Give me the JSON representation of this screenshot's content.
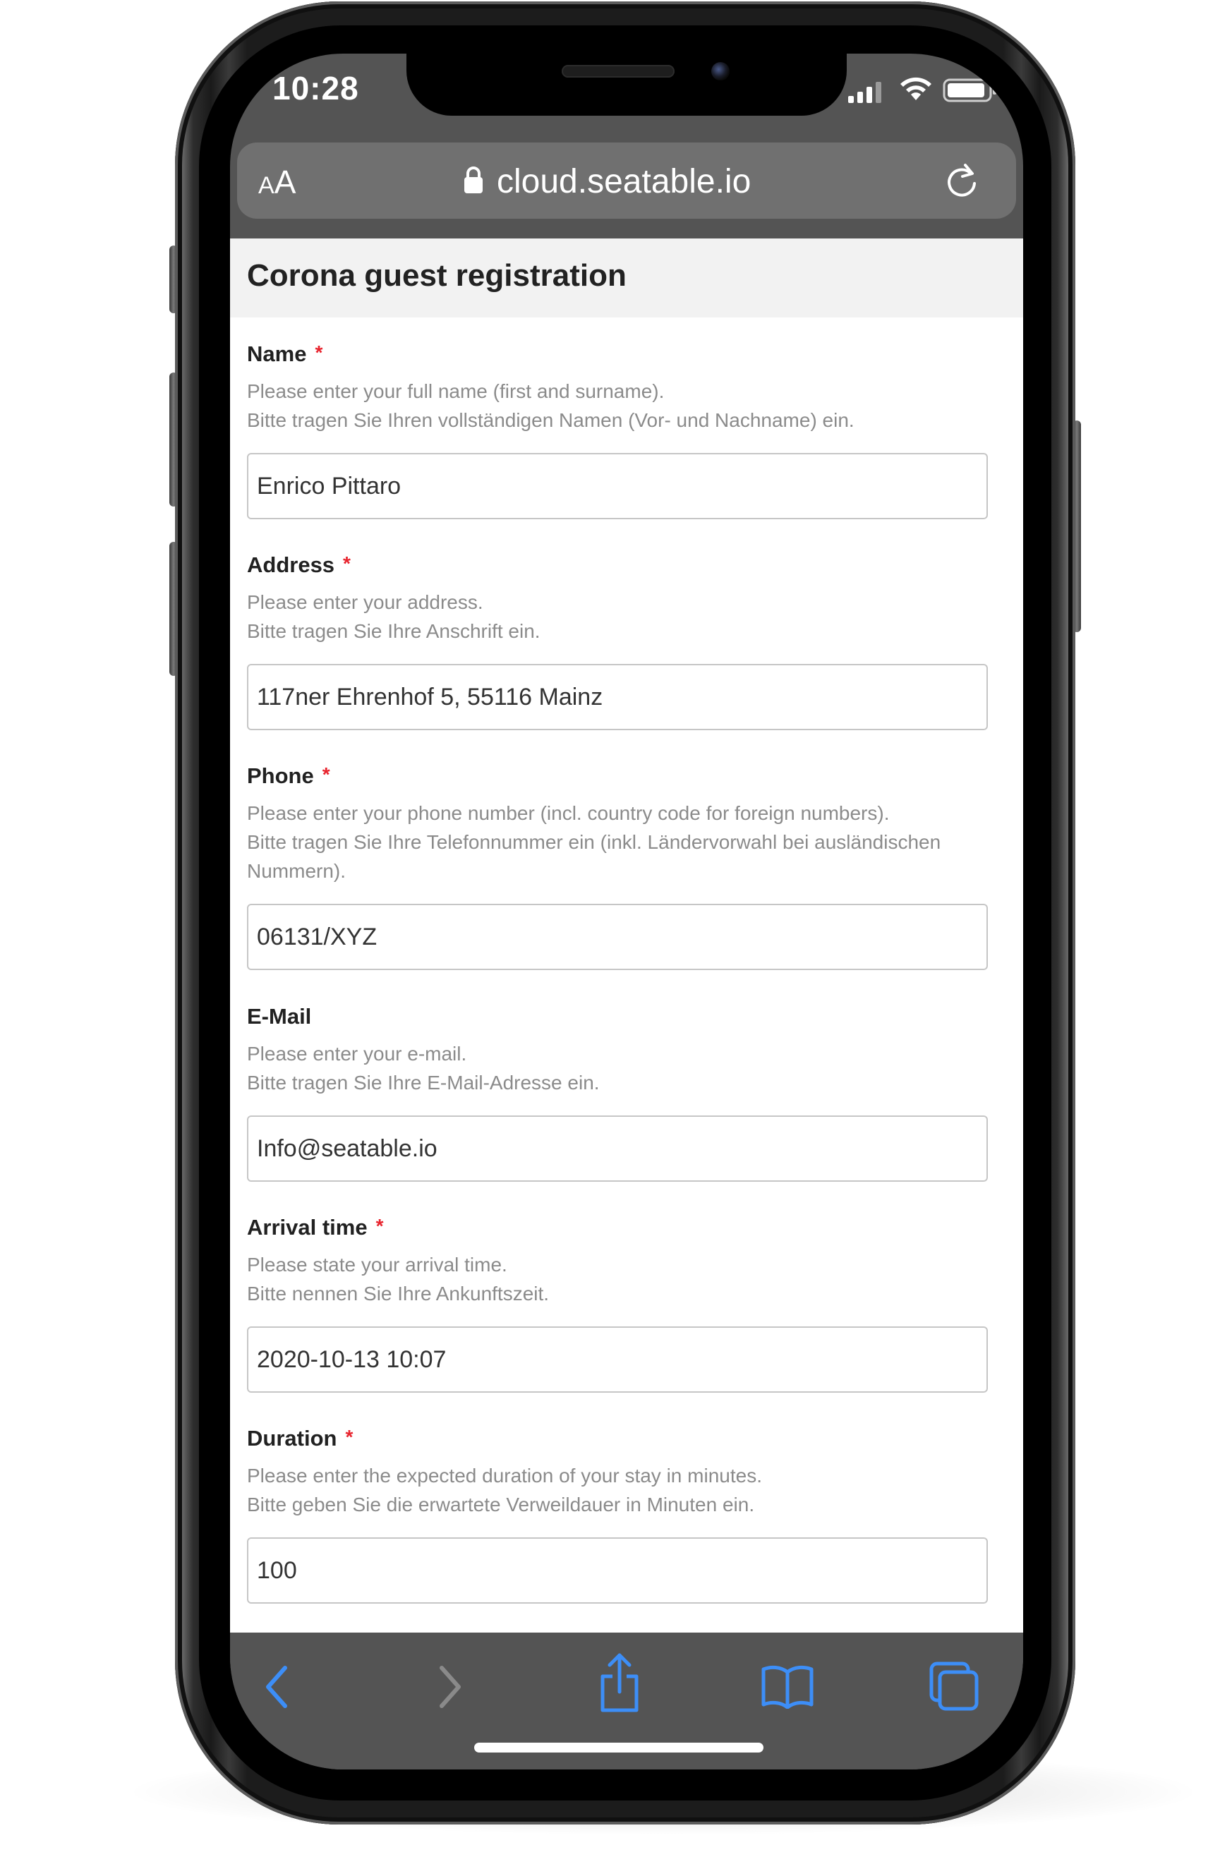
{
  "status_bar": {
    "time": "10:28"
  },
  "browser": {
    "text_size_button": {
      "small": "A",
      "large": "A"
    },
    "url": "cloud.seatable.io"
  },
  "form": {
    "title": "Corona guest registration",
    "required_marker": "*",
    "fields": [
      {
        "label": "Name",
        "required": true,
        "help_en": "Please enter your full name (first and surname).",
        "help_de": "Bitte tragen Sie Ihren vollständigen Namen (Vor- und Nachname) ein.",
        "value": "Enrico Pittaro"
      },
      {
        "label": "Address",
        "required": true,
        "help_en": "Please enter your address.",
        "help_de": "Bitte tragen Sie Ihre Anschrift ein.",
        "value": "117ner Ehrenhof 5, 55116 Mainz"
      },
      {
        "label": "Phone",
        "required": true,
        "help_en": "Please enter your phone number (incl. country code for foreign numbers).",
        "help_de": "Bitte tragen Sie Ihre Telefonnummer ein (inkl. Ländervorwahl bei ausländischen Nummern).",
        "value": "06131/XYZ"
      },
      {
        "label": "E-Mail",
        "required": false,
        "help_en": "Please enter your e-mail.",
        "help_de": "Bitte tragen Sie Ihre E-Mail-Adresse ein.",
        "value": "Info@seatable.io"
      },
      {
        "label": "Arrival time",
        "required": true,
        "help_en": "Please state your arrival time.",
        "help_de": "Bitte nennen Sie Ihre Ankunftszeit.",
        "value": "2020-10-13 10:07"
      },
      {
        "label": "Duration",
        "required": true,
        "help_en": "Please enter the expected duration of your stay in minutes.",
        "help_de": "Bitte geben Sie die erwartete Verweildauer in Minuten ein.",
        "value": "100"
      }
    ]
  },
  "toolbar": {
    "icons": [
      "back-icon",
      "forward-icon",
      "share-icon",
      "bookmarks-icon",
      "tabs-icon"
    ],
    "active_color": "#3d8ef7",
    "disabled_color": "#8a8a8a"
  },
  "colors": {
    "chrome_gray": "#545454",
    "required_red": "#e8242e"
  }
}
